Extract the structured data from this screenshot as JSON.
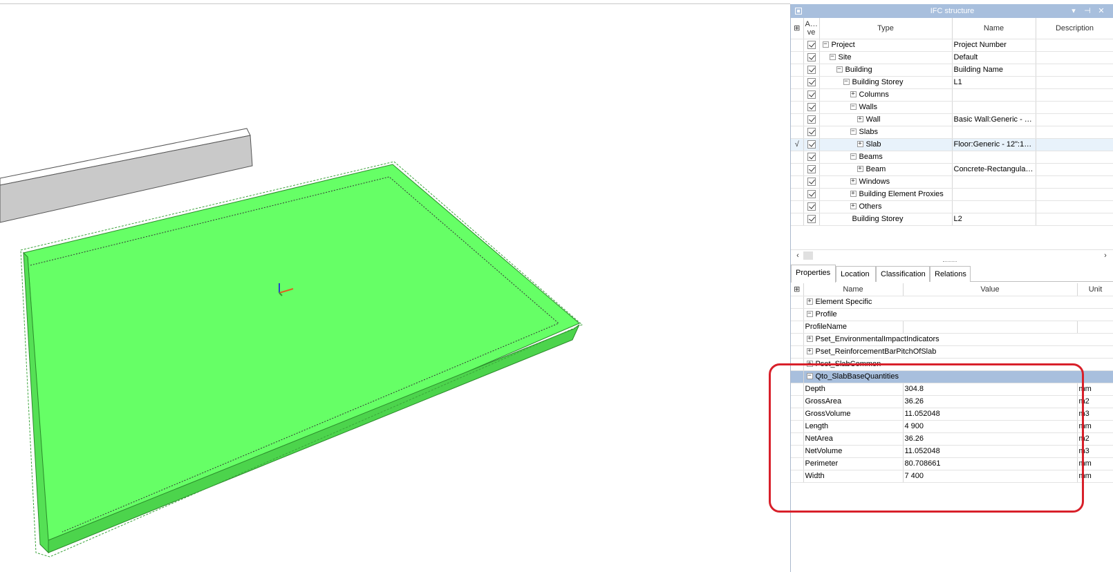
{
  "ifc_panel": {
    "title": "IFC structure",
    "columns": {
      "active": "Acti ve",
      "type": "Type",
      "name": "Name",
      "description": "Description"
    },
    "rows": [
      {
        "mark": "",
        "type": "Project",
        "name": "Project Number",
        "toggle": "−"
      },
      {
        "mark": "",
        "type": "Site",
        "name": "Default",
        "toggle": "−"
      },
      {
        "mark": "",
        "type": "Building",
        "name": "Building Name",
        "toggle": "−"
      },
      {
        "mark": "",
        "type": "Building Storey",
        "name": "L1",
        "toggle": "−"
      },
      {
        "mark": "",
        "type": "Columns",
        "name": "",
        "toggle": "+"
      },
      {
        "mark": "",
        "type": "Walls",
        "name": "",
        "toggle": "−"
      },
      {
        "mark": "",
        "type": "Wall",
        "name": "Basic Wall:Generic - 2...",
        "toggle": "+"
      },
      {
        "mark": "",
        "type": "Slabs",
        "name": "",
        "toggle": "−"
      },
      {
        "mark": "√",
        "type": "Slab",
        "name": "Floor:Generic - 12\":15...",
        "toggle": "+"
      },
      {
        "mark": "",
        "type": "Beams",
        "name": "",
        "toggle": "−"
      },
      {
        "mark": "",
        "type": "Beam",
        "name": "Concrete-Rectangular...",
        "toggle": "+"
      },
      {
        "mark": "",
        "type": "Windows",
        "name": "",
        "toggle": "+"
      },
      {
        "mark": "",
        "type": "Building Element Proxies",
        "name": "",
        "toggle": "+"
      },
      {
        "mark": "",
        "type": "Others",
        "name": "",
        "toggle": "+"
      },
      {
        "mark": "",
        "type": "Building Storey",
        "name": "L2",
        "toggle": ""
      }
    ]
  },
  "tabs": [
    "Properties",
    "Location",
    "Classification",
    "Relations"
  ],
  "properties": {
    "columns": {
      "name": "Name",
      "value": "Value",
      "unit": "Unit"
    },
    "groups": [
      {
        "label": "Element Specific",
        "toggle": "+"
      },
      {
        "label": "Profile",
        "toggle": "−"
      }
    ],
    "profile_name": "ProfileName",
    "groups2": [
      {
        "label": "Pset_EnvironmentalImpactIndicators",
        "toggle": "+"
      },
      {
        "label": "Pset_ReinforcementBarPitchOfSlab",
        "toggle": "+"
      },
      {
        "label": "Pset_SlabCommon",
        "toggle": "+"
      }
    ],
    "qto_group": {
      "label": "Qto_SlabBaseQuantities",
      "toggle": "−"
    },
    "qto_rows": [
      {
        "name": "Depth",
        "value": "304.8",
        "unit": "mm"
      },
      {
        "name": "GrossArea",
        "value": "36.26",
        "unit": "m2"
      },
      {
        "name": "GrossVolume",
        "value": "11.052048",
        "unit": "m3"
      },
      {
        "name": "Length",
        "value": "4 900",
        "unit": "mm"
      },
      {
        "name": "NetArea",
        "value": "36.26",
        "unit": "m2"
      },
      {
        "name": "NetVolume",
        "value": "11.052048",
        "unit": "m3"
      },
      {
        "name": "Perimeter",
        "value": "80.708661",
        "unit": "mm"
      },
      {
        "name": "Width",
        "value": "7 400",
        "unit": "mm"
      }
    ]
  },
  "colors": {
    "slab": "#66ff66",
    "selection": "#a8bfdd",
    "highlight": "#d8202a"
  }
}
